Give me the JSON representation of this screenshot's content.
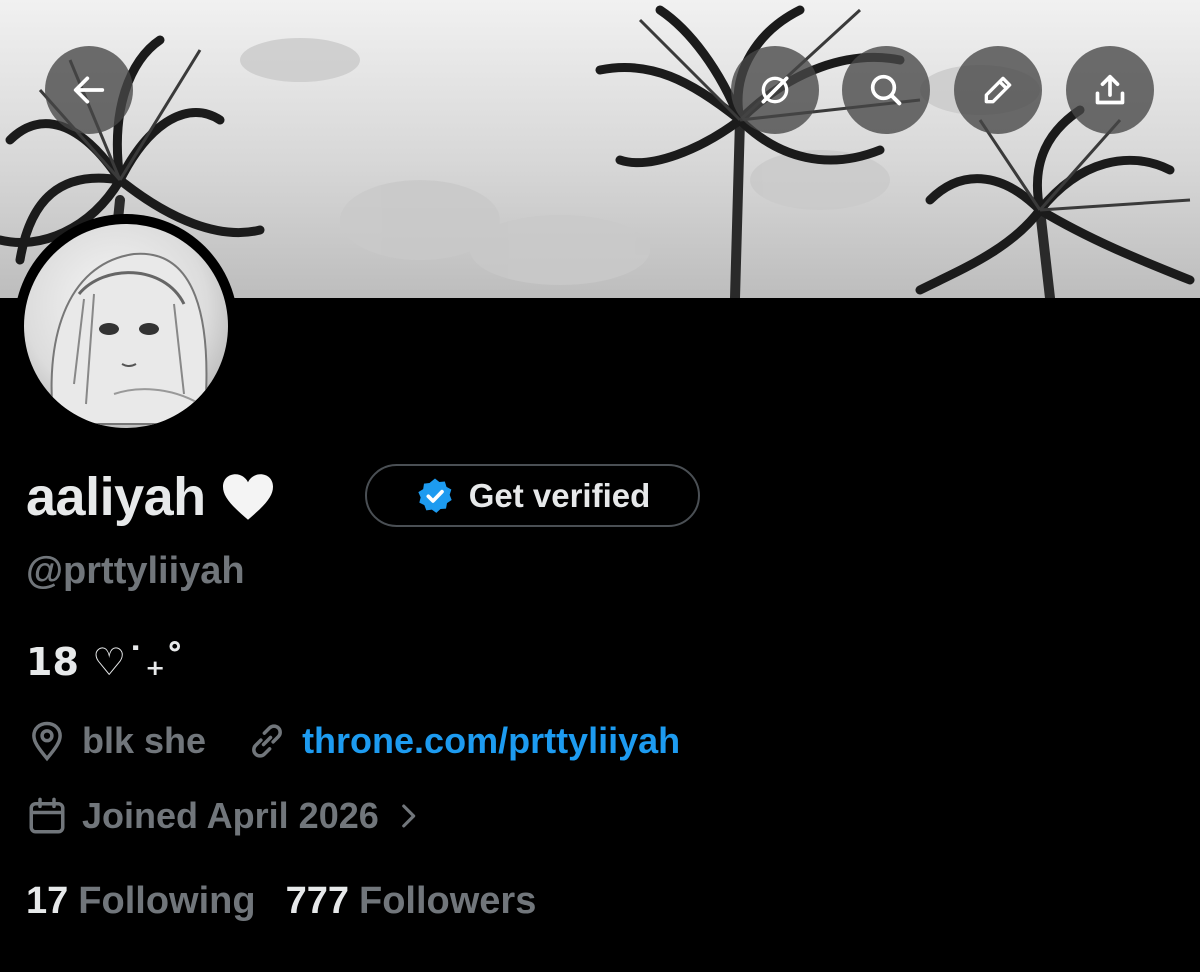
{
  "profile": {
    "display_name": "aaliyah",
    "name_emoji": "white-heart",
    "handle": "@prttyliiyah",
    "bio": "18 ♡˙₊˚",
    "location": "blk she",
    "website": "throne.com/prttyliiyah",
    "joined": "Joined April 2026",
    "following_count": "17",
    "following_label": "Following",
    "followers_count": "777",
    "followers_label": "Followers"
  },
  "get_verified": {
    "label": "Get verified"
  },
  "header_buttons": [
    "back-arrow-icon",
    "grok-icon",
    "search-icon",
    "edit-pencil-icon",
    "share-icon"
  ],
  "colors": {
    "background": "#000000",
    "text": "#e7e9ea",
    "muted": "#71767b",
    "link": "#1d9bf0",
    "verified_badge": "#1d9bf0"
  }
}
